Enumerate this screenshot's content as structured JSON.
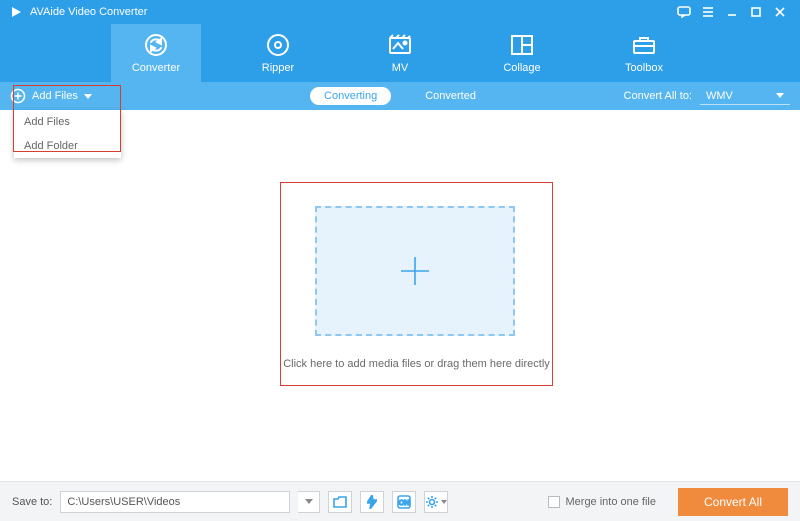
{
  "app": {
    "title": "AVAide Video Converter"
  },
  "nav": {
    "converter": "Converter",
    "ripper": "Ripper",
    "mv": "MV",
    "collage": "Collage",
    "toolbox": "Toolbox"
  },
  "subbar": {
    "add_files": "Add Files",
    "converting": "Converting",
    "converted": "Converted",
    "convert_all_to": "Convert All to:",
    "format": "WMV"
  },
  "addfiles_menu": {
    "add_files": "Add Files",
    "add_folder": "Add Folder"
  },
  "drop": {
    "hint": "Click here to add media files or drag them here directly"
  },
  "bottom": {
    "save_to": "Save to:",
    "path": "C:\\Users\\USER\\Videos",
    "merge": "Merge into one file",
    "convert_all": "Convert All"
  }
}
